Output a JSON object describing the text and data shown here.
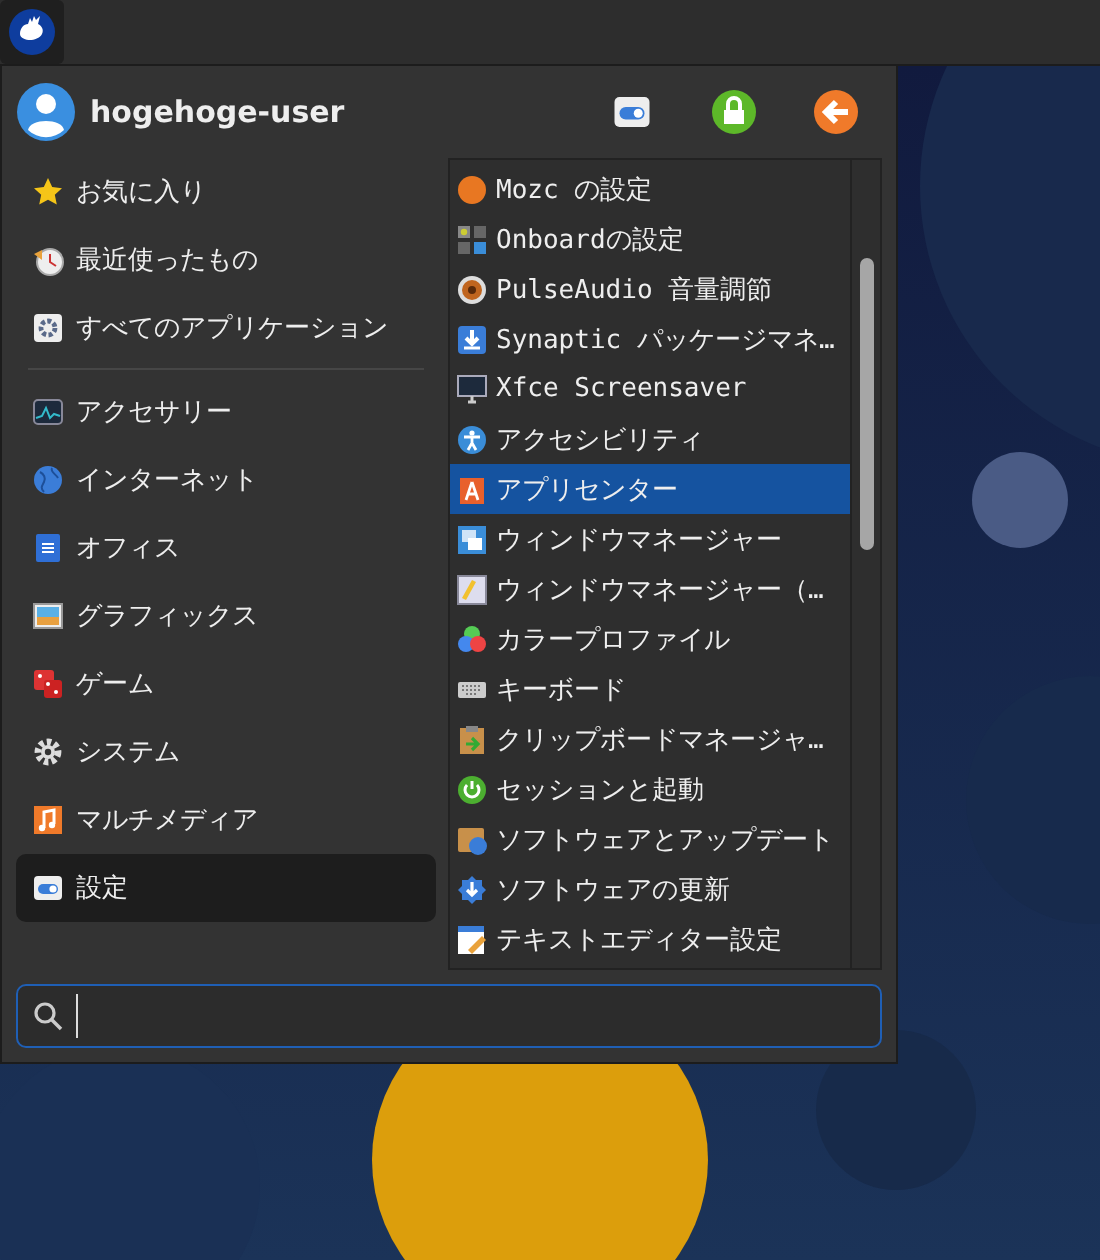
{
  "user": {
    "name": "hogehoge-user"
  },
  "categories": [
    {
      "label": "お気に入り",
      "selected": false
    },
    {
      "label": "最近使ったもの",
      "selected": false
    },
    {
      "label": "すべてのアプリケーション",
      "selected": false
    },
    {
      "label": "アクセサリー",
      "selected": false
    },
    {
      "label": "インターネット",
      "selected": false
    },
    {
      "label": "オフィス",
      "selected": false
    },
    {
      "label": "グラフィックス",
      "selected": false
    },
    {
      "label": "ゲーム",
      "selected": false
    },
    {
      "label": "システム",
      "selected": false
    },
    {
      "label": "マルチメディア",
      "selected": false
    },
    {
      "label": "設定",
      "selected": true
    }
  ],
  "apps": [
    {
      "label": "Mozc の設定",
      "selected": false
    },
    {
      "label": "Onboardの設定",
      "selected": false
    },
    {
      "label": "PulseAudio 音量調節",
      "selected": false
    },
    {
      "label": "Synaptic パッケージマネ…",
      "selected": false
    },
    {
      "label": "Xfce Screensaver",
      "selected": false
    },
    {
      "label": "アクセシビリティ",
      "selected": false
    },
    {
      "label": "アプリセンター",
      "selected": true
    },
    {
      "label": "ウィンドウマネージャー",
      "selected": false
    },
    {
      "label": "ウィンドウマネージャー（…",
      "selected": false
    },
    {
      "label": "カラープロファイル",
      "selected": false
    },
    {
      "label": "キーボード",
      "selected": false
    },
    {
      "label": "クリップボードマネージャ…",
      "selected": false
    },
    {
      "label": "セッションと起動",
      "selected": false
    },
    {
      "label": "ソフトウェアとアップデート",
      "selected": false
    },
    {
      "label": "ソフトウェアの更新",
      "selected": false
    },
    {
      "label": "テキストエディター設定",
      "selected": false
    }
  ]
}
